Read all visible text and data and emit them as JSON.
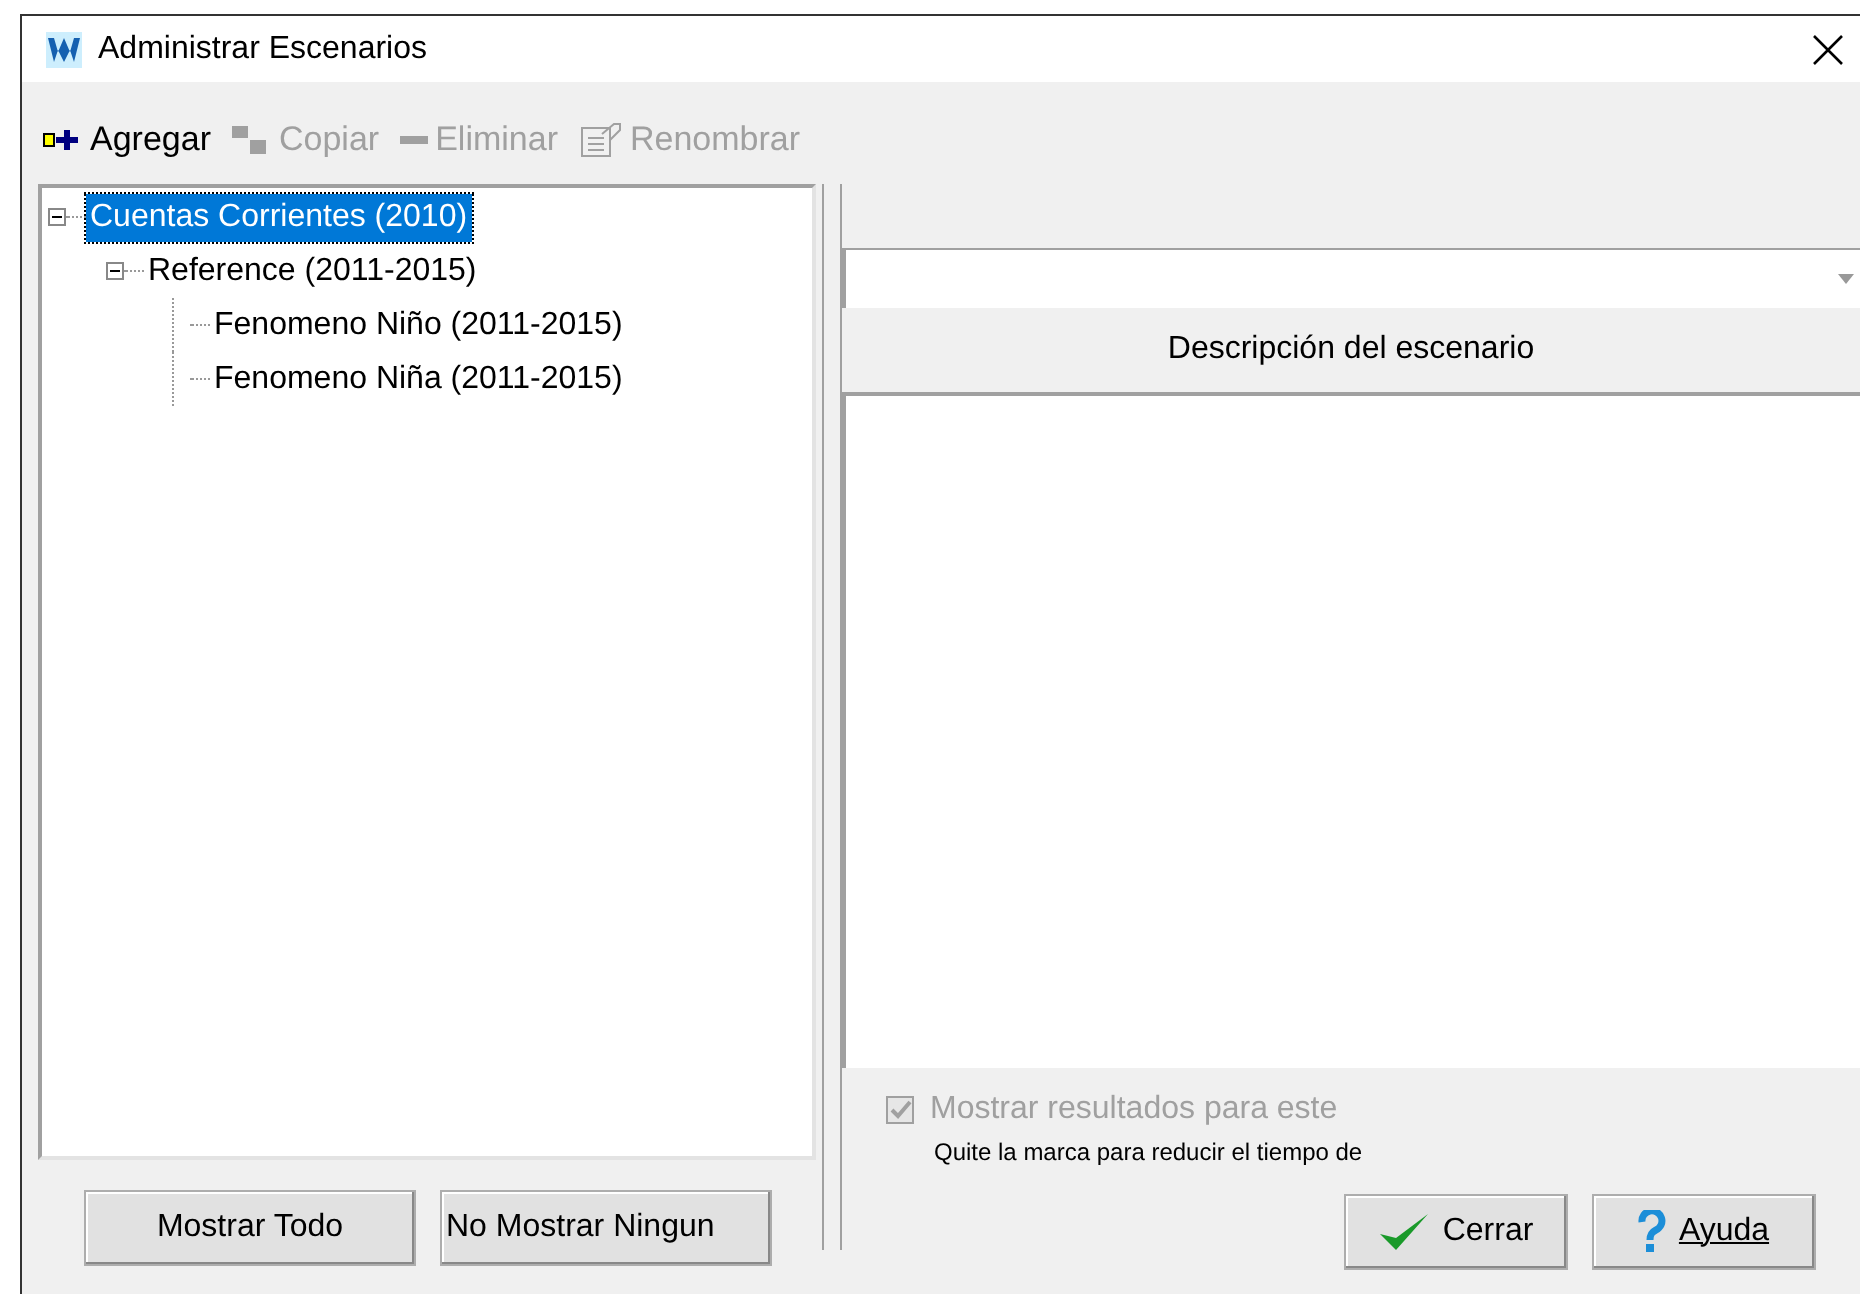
{
  "window": {
    "title": "Administrar Escenarios"
  },
  "toolbar": [
    {
      "label": "Agregar",
      "disabled": false,
      "kind": "add"
    },
    {
      "label": "Copiar",
      "disabled": true,
      "kind": "copy"
    },
    {
      "label": "Eliminar",
      "disabled": true,
      "kind": "delete"
    },
    {
      "label": "Renombrar",
      "disabled": true,
      "kind": "rename"
    }
  ],
  "tree": [
    {
      "label": "Cuentas Corrientes (2010)",
      "selected": true,
      "expanded": true,
      "children": [
        {
          "label": "Reference (2011-2015)",
          "selected": false,
          "expanded": true,
          "children": [
            {
              "label": "Fenomeno Niño (2011-2015)",
              "selected": false
            },
            {
              "label": "Fenomeno Niña (2011-2015)",
              "selected": false
            }
          ]
        }
      ]
    }
  ],
  "description_header": "Descripción del escenario",
  "show_results": {
    "label": "Mostrar resultados para este",
    "checked": true,
    "disabled": true
  },
  "note": "Quite la marca para reducir el tiempo de",
  "left_buttons": [
    "Mostrar Todo",
    "No Mostrar Ningun"
  ],
  "right_buttons": [
    {
      "label": "Cerrar",
      "kind": "ok"
    },
    {
      "label": "Ayuda",
      "kind": "help"
    }
  ]
}
